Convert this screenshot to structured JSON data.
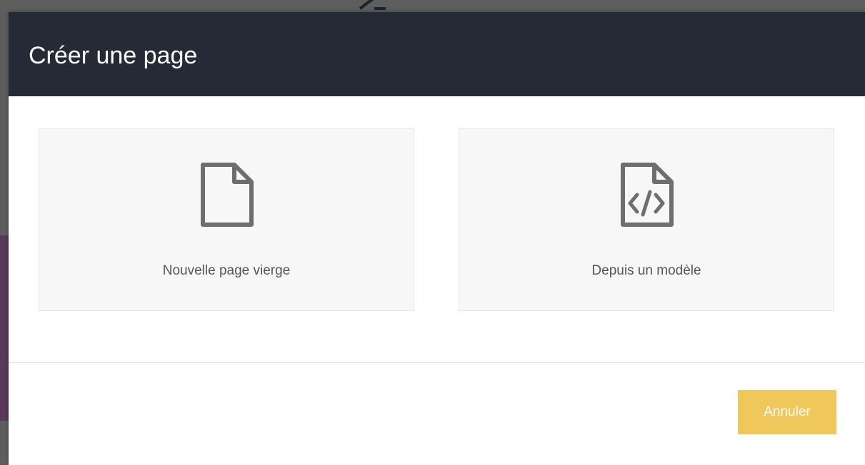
{
  "modal": {
    "title": "Créer une page",
    "options": [
      {
        "label": "Nouvelle page vierge",
        "icon": "blank-file-icon"
      },
      {
        "label": "Depuis un modèle",
        "icon": "code-file-icon"
      }
    ],
    "cancel_label": "Annuler"
  },
  "colors": {
    "header_bg": "#262a37",
    "accent_button": "#f0c75a",
    "card_bg": "#f7f7f7",
    "icon_stroke": "#6e6e6e"
  }
}
